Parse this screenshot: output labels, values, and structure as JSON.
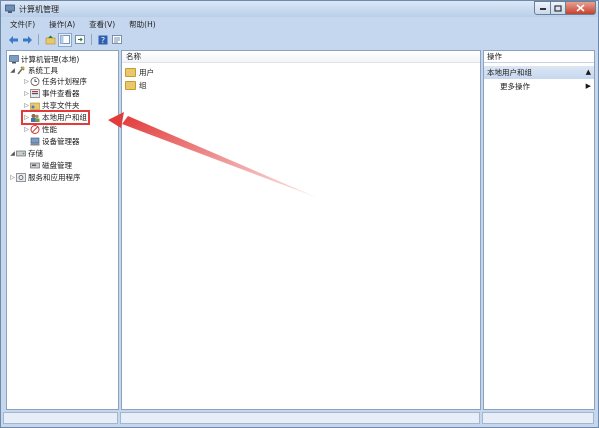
{
  "window": {
    "title": "计算机管理"
  },
  "menu": [
    "文件(F)",
    "操作(A)",
    "查看(V)",
    "帮助(H)"
  ],
  "toolbar": [
    "back-icon",
    "forward-icon",
    "up-icon",
    "show-hide-tree-icon",
    "export-icon",
    "help-icon",
    "properties-icon"
  ],
  "tree": {
    "root": "计算机管理(本地)",
    "system_tools": "系统工具",
    "task_scheduler": "任务计划程序",
    "event_viewer": "事件查看器",
    "shared_folders": "共享文件夹",
    "local_users_groups": "本地用户和组",
    "performance": "性能",
    "device_manager": "设备管理器",
    "storage": "存储",
    "disk_management": "磁盘管理",
    "services_apps": "服务和应用程序"
  },
  "list": {
    "column_name": "名称",
    "items": [
      "用户",
      "组"
    ]
  },
  "actions": {
    "header": "操作",
    "group": "本地用户和组",
    "more": "更多操作"
  },
  "colors": {
    "highlight": "#e23b3b",
    "accent": "#c6d7ee"
  }
}
